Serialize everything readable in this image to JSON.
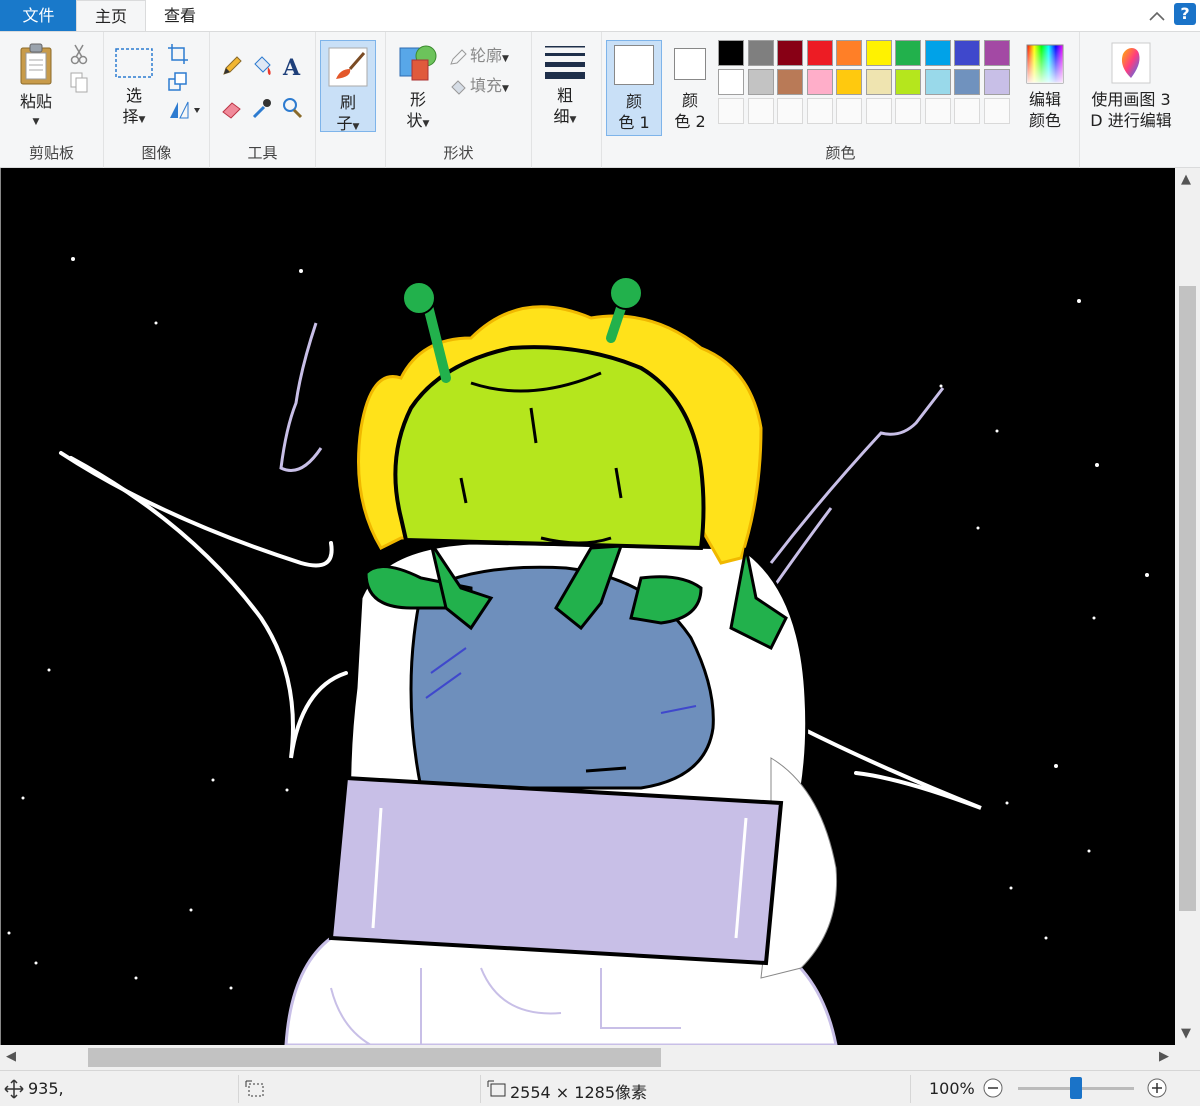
{
  "tabs": {
    "file": "文件",
    "home": "主页",
    "view": "查看"
  },
  "ribbon": {
    "clipboard": {
      "group_label": "剪贴板",
      "paste_label": "粘贴"
    },
    "image": {
      "group_label": "图像",
      "select_label_1": "选",
      "select_label_2": "择"
    },
    "tools": {
      "group_label": "工具"
    },
    "brushes": {
      "label_1": "刷",
      "label_2": "子"
    },
    "shapes": {
      "group_label": "形状",
      "shapes_label_1": "形",
      "shapes_label_2": "状",
      "outline_label": "轮廓",
      "fill_label": "填充"
    },
    "size": {
      "label_1": "粗",
      "label_2": "细"
    },
    "colors": {
      "group_label": "颜色",
      "color1_label_1": "颜",
      "color1_label_2": "色 1",
      "color2_label_1": "颜",
      "color2_label_2": "色 2",
      "color1_value": "#ffffff",
      "color2_value": "#ffffff",
      "palette_row1": [
        "#000000",
        "#7f7f7f",
        "#880015",
        "#ed1c24",
        "#ff7f27",
        "#fff200",
        "#22b14c",
        "#00a2e8",
        "#3f48cc",
        "#a349a4"
      ],
      "palette_row2": [
        "#ffffff",
        "#c3c3c3",
        "#b97a57",
        "#ffaec9",
        "#ffc90e",
        "#efe4b0",
        "#b5e61d",
        "#99d9ea",
        "#7092be",
        "#c8bfe7"
      ],
      "edit_colors_label_1": "编辑",
      "edit_colors_label_2": "颜色"
    },
    "paint3d": {
      "label_1": "使用画图 3",
      "label_2": "D 进行编辑"
    }
  },
  "status": {
    "cursor_position": "935,",
    "image_size": "2554 × 1285像素",
    "zoom": "100%",
    "zoom_level": 0.5
  }
}
